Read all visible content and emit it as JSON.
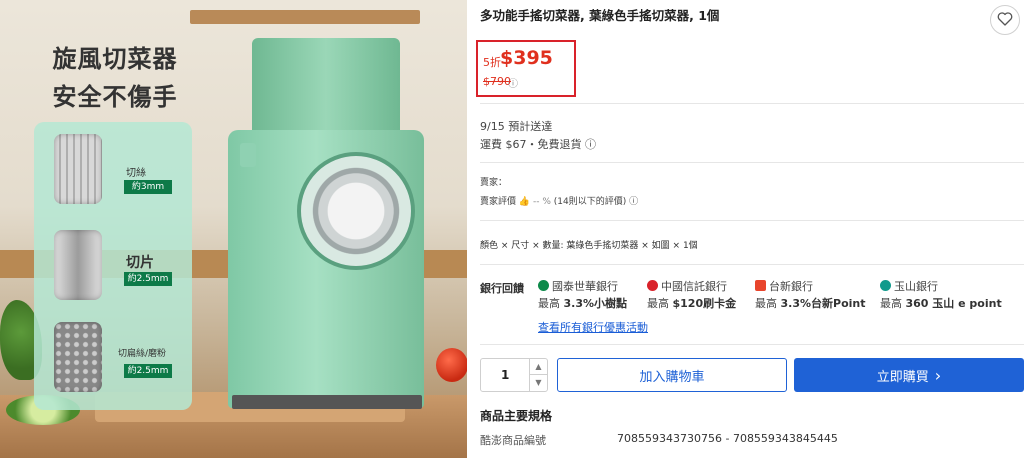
{
  "image": {
    "promo_line1": "旋風切菜器",
    "promo_line2": "安全不傷手",
    "blades": [
      {
        "label": "切絲",
        "size": "約3mm"
      },
      {
        "label": "切片",
        "size": "約2.5mm"
      },
      {
        "label": "切扁絲/磨粉",
        "size": "約2.5mm"
      }
    ]
  },
  "product": {
    "title": "多功能手搖切菜器, 葉綠色手搖切菜器, 1個",
    "favorite_icon": "heart-icon"
  },
  "price": {
    "discount": "5折",
    "current": "$395",
    "original": "$790",
    "info_icon": "ⓘ",
    "accent_color": "#e0301e",
    "highlight_border": "#d9222a"
  },
  "shipping": {
    "date": "9/15  預計送達",
    "fee": "運費 $67・免費退貨 ⓘ"
  },
  "seller": {
    "label": "賣家：",
    "rating_label": "賣家評價",
    "rating_value": "-- %",
    "rating_note": "(14則以下的評價) ⓘ"
  },
  "selection": {
    "text": "顏色 × 尺寸 × 數量: 葉綠色手搖切菜器 × 如圖 × 1個"
  },
  "banks": {
    "title": "銀行回饋",
    "items": [
      {
        "name": "國泰世華銀行",
        "offer_prefix": "最高",
        "offer": "3.3%小樹點",
        "logo_color": "#0d8a4a"
      },
      {
        "name": "中國信託銀行",
        "offer_prefix": "最高",
        "offer": "$120刷卡金",
        "logo_color": "#d9222a"
      },
      {
        "name": "台新銀行",
        "offer_prefix": "最高",
        "offer": "3.3%台新Point",
        "logo_color": "#e8452c"
      },
      {
        "name": "玉山銀行",
        "offer_prefix": "最高",
        "offer": "360 玉山 e point",
        "logo_color": "#119a8c"
      }
    ],
    "link": "查看所有銀行優惠活動"
  },
  "purchase": {
    "quantity": "1",
    "add_to_cart": "加入購物車",
    "buy_now": "立即購買",
    "buy_now_arrow": "›",
    "primary_color": "#1f62d6"
  },
  "specs": {
    "heading": "商品主要規格",
    "rows": [
      {
        "key": "酷澎商品編號",
        "value": "708559343730756 - 708559343845445"
      }
    ]
  }
}
